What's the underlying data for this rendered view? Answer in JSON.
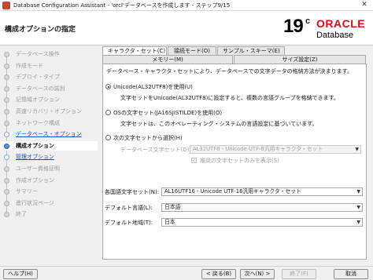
{
  "window": {
    "title": "Database Configuration Assistant - 'orcl'データベースを作成します - ステップ9/15",
    "close_glyph": "✕"
  },
  "header": {
    "page_title": "構成オプションの指定",
    "brand_version": "19",
    "brand_version_suffix": "c",
    "brand_name": "ORACLE",
    "brand_product": "Database"
  },
  "sidebar": {
    "steps": [
      {
        "label": "データベース操作",
        "state": "done"
      },
      {
        "label": "作成モード",
        "state": "done"
      },
      {
        "label": "デプロイ・タイプ",
        "state": "done"
      },
      {
        "label": "データベースの識別",
        "state": "done"
      },
      {
        "label": "記憶域オプション",
        "state": "done"
      },
      {
        "label": "高速リカバリ・オプション",
        "state": "done"
      },
      {
        "label": "ネットワーク構成",
        "state": "done"
      },
      {
        "label": "データベース・オプション",
        "state": "link"
      },
      {
        "label": "構成オプション",
        "state": "current"
      },
      {
        "label": "管理オプション",
        "state": "link"
      },
      {
        "label": "ユーザー資格証明",
        "state": "todo"
      },
      {
        "label": "作成オプション",
        "state": "todo"
      },
      {
        "label": "サマリー",
        "state": "todo"
      },
      {
        "label": "進行状況ページ",
        "state": "todo"
      },
      {
        "label": "終了",
        "state": "todo"
      }
    ]
  },
  "tabs": {
    "row1": [
      "キャラクタ・セット(C)",
      "接続モード(O)",
      "サンプル・スキーマ(E)"
    ],
    "row2": [
      "メモリー(M)",
      "サイズ設定(Z)"
    ]
  },
  "charset": {
    "description": "データベース・キャラクタ・セットにより、データベースでの文字データの格納方法が決まります。",
    "unicode_option": "Unicode(AL32UTF8)を使用(U)",
    "unicode_desc_1": "文字セットをUnicode(AL32UTF8)に設定すると、複数の言語グループを格納できます。",
    "os_option": "OSの文字セット(JA16SJISTILDE)を使用(O)",
    "os_desc_1": "文字セットは、このオペレーティング・システムの言語設定に基づいています。",
    "list_option": "次の文字セットから選択(H)",
    "db_charset_label": "データベース文字セット(D):",
    "db_charset_value": "AL32UTF8 - Unicode UTF-8汎用キャラクタ・セット",
    "recommended_only": "推奨の文字セットのみを表示(S)",
    "national_label": "各国語文字セット(N):",
    "national_value": "AL16UTF16 - Unicode UTF-16汎用キャラクタ・セット",
    "language_label": "デフォルト言語(L):",
    "language_value": "日本語",
    "territory_label": "デフォルト地域(T):",
    "territory_value": "日本",
    "dropdown_arrow": "▼"
  },
  "footer": {
    "help": "ヘルプ(H)",
    "back": "< 戻る(B)",
    "next": "次へ(N) >",
    "finish": "終了(F)",
    "cancel": "取消"
  }
}
